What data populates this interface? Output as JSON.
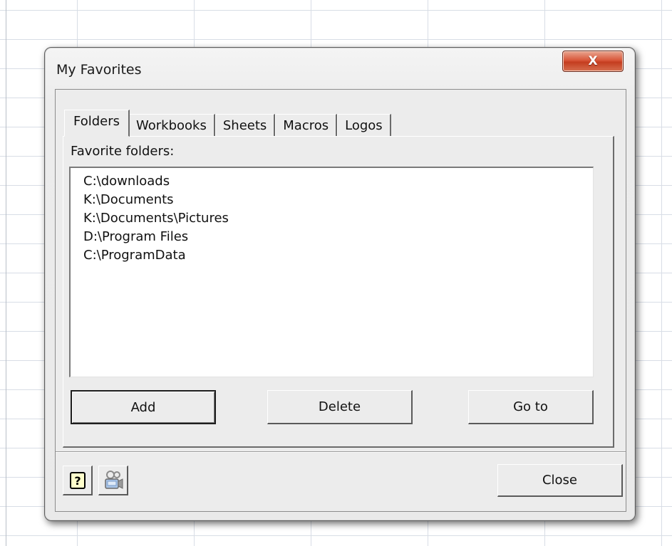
{
  "dialog": {
    "title": "My Favorites",
    "close_glyph": "X"
  },
  "tabs": [
    {
      "label": "Folders",
      "active": true
    },
    {
      "label": "Workbooks",
      "active": false
    },
    {
      "label": "Sheets",
      "active": false
    },
    {
      "label": "Macros",
      "active": false
    },
    {
      "label": "Logos",
      "active": false
    }
  ],
  "folders": {
    "list_label": "Favorite folders:",
    "items": [
      "C:\\downloads",
      "K:\\Documents",
      "K:\\Documents\\Pictures",
      "D:\\Program Files",
      "C:\\ProgramData"
    ],
    "add_label": "Add",
    "delete_label": "Delete",
    "goto_label": "Go to"
  },
  "footer": {
    "help_icon": "help-icon",
    "record_icon": "video-camera-icon",
    "close_label": "Close"
  },
  "colors": {
    "close_button": "#d9573a",
    "dialog_face": "#ececec",
    "grid_line": "#d8dde6"
  }
}
